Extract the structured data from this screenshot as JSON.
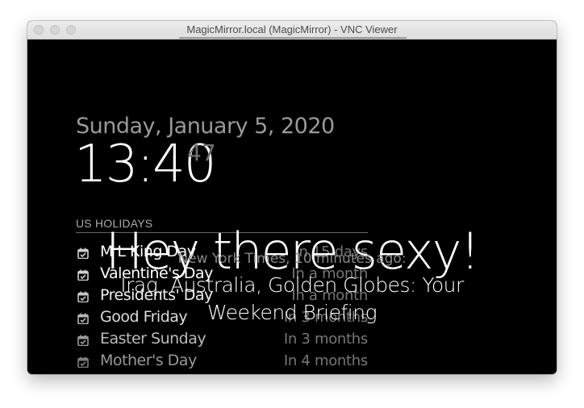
{
  "window": {
    "title": "MagicMirror.local (MagicMirror) - VNC Viewer"
  },
  "clock": {
    "date": "Sunday, January 5, 2020",
    "time": "13:40",
    "seconds": "47"
  },
  "calendar": {
    "header": "US HOLIDAYS",
    "events": [
      {
        "title": "M L King Day",
        "when": "In 15 days",
        "title_color": "#ffffff"
      },
      {
        "title": "Valentine's Day",
        "when": "In a month",
        "title_color": "#ffffff"
      },
      {
        "title": "Presidents' Day",
        "when": "In a month",
        "title_color": "#eeeeee"
      },
      {
        "title": "Good Friday",
        "when": "In 3 months",
        "title_color": "#dddddd"
      },
      {
        "title": "Easter Sunday",
        "when": "In 3 months",
        "title_color": "#bbbbbb"
      },
      {
        "title": "Mother's Day",
        "when": "In 4 months",
        "title_color": "#999999"
      }
    ]
  },
  "compliments": {
    "text": "Hey there sexy!"
  },
  "news": {
    "source": "New York Times, 10 minutes ago:",
    "headline": "Iraq, Australia, Golden Globes: Your Weekend Briefing"
  },
  "colors": {
    "background": "#000000",
    "dimmed": "#999999",
    "bright": "#ffffff"
  }
}
